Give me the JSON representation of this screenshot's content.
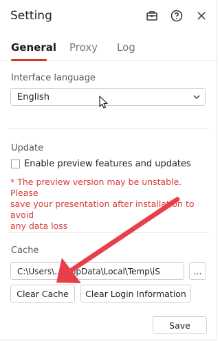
{
  "window": {
    "title": "Setting",
    "icons": [
      "briefcase-icon",
      "help-icon",
      "close-icon"
    ]
  },
  "tabs": [
    {
      "label": "General",
      "active": true
    },
    {
      "label": "Proxy",
      "active": false
    },
    {
      "label": "Log",
      "active": false
    }
  ],
  "interface_language": {
    "label": "Interface language",
    "selected": "English"
  },
  "update": {
    "label": "Update",
    "checkbox_label": "Enable preview features and updates",
    "checked": false,
    "warning_lines": [
      "* The preview version may be unstable. Please",
      "save your presentation after installation to avoid",
      "any data loss"
    ]
  },
  "cache": {
    "label": "Cache",
    "path": "C:\\Users\\...\\AppData\\Local\\Temp\\iS",
    "browse_label": "...",
    "clear_cache_label": "Clear Cache",
    "clear_login_label": "Clear Login Information"
  },
  "footer": {
    "save_label": "Save"
  },
  "colors": {
    "accent": "#d9362b",
    "warning": "#d83a3a",
    "annotation_arrow": "#e8404b"
  }
}
